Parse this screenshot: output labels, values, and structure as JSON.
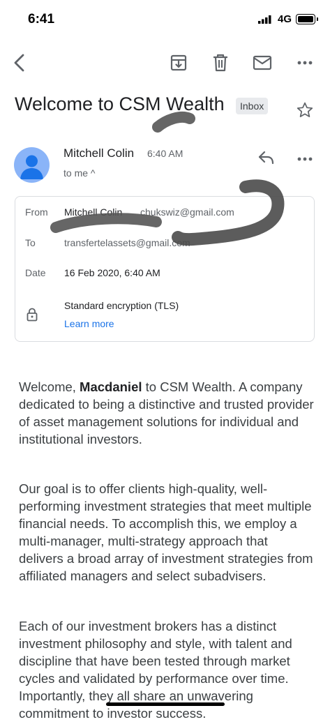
{
  "status_bar": {
    "time": "6:41",
    "network": "4G"
  },
  "toolbar": {
    "back": "back-arrow-icon",
    "archive": "archive-icon",
    "delete": "trash-icon",
    "mark_unread": "mail-icon",
    "more": "more-horizontal-icon"
  },
  "email": {
    "subject": "Welcome to CSM Wealth",
    "label": "Inbox",
    "sender": {
      "name": "Mitchell Colin",
      "time": "6:40 AM",
      "recipient_summary": "to me ^"
    },
    "details": {
      "from_label": "From",
      "from_name": "Mitchell Colin",
      "from_email": "chukswiz@gmail.com",
      "to_label": "To",
      "to_email": "transfertelassets@gmail.com",
      "date_label": "Date",
      "date_value": "16 Feb 2020, 6:40 AM",
      "encryption": "Standard encryption (TLS)",
      "learn_more": "Learn more"
    },
    "body": {
      "p1_pre": "Welcome, ",
      "p1_bold": "Macdaniel",
      "p1_post": " to CSM Wealth. A company dedicated to being a distinctive and trusted provider of asset management solutions for individual and institutional investors.",
      "p2": "Our goal is to offer clients high-quality, well-performing investment strategies that meet multiple financial needs. To accomplish this, we employ a multi-manager, multi-strategy approach that delivers a broad array of investment strategies from affiliated managers and select subadvisers.",
      "p3": "Each of our investment brokers has a distinct investment philosophy and style, with talent and discipline that have been tested through market cycles and validated by performance over time. Importantly, they all share an unwavering commitment to investor success."
    }
  },
  "colors": {
    "link": "#1a73e8",
    "avatar_bg": "#8ab4f8",
    "avatar_fg": "#1a73e8"
  }
}
